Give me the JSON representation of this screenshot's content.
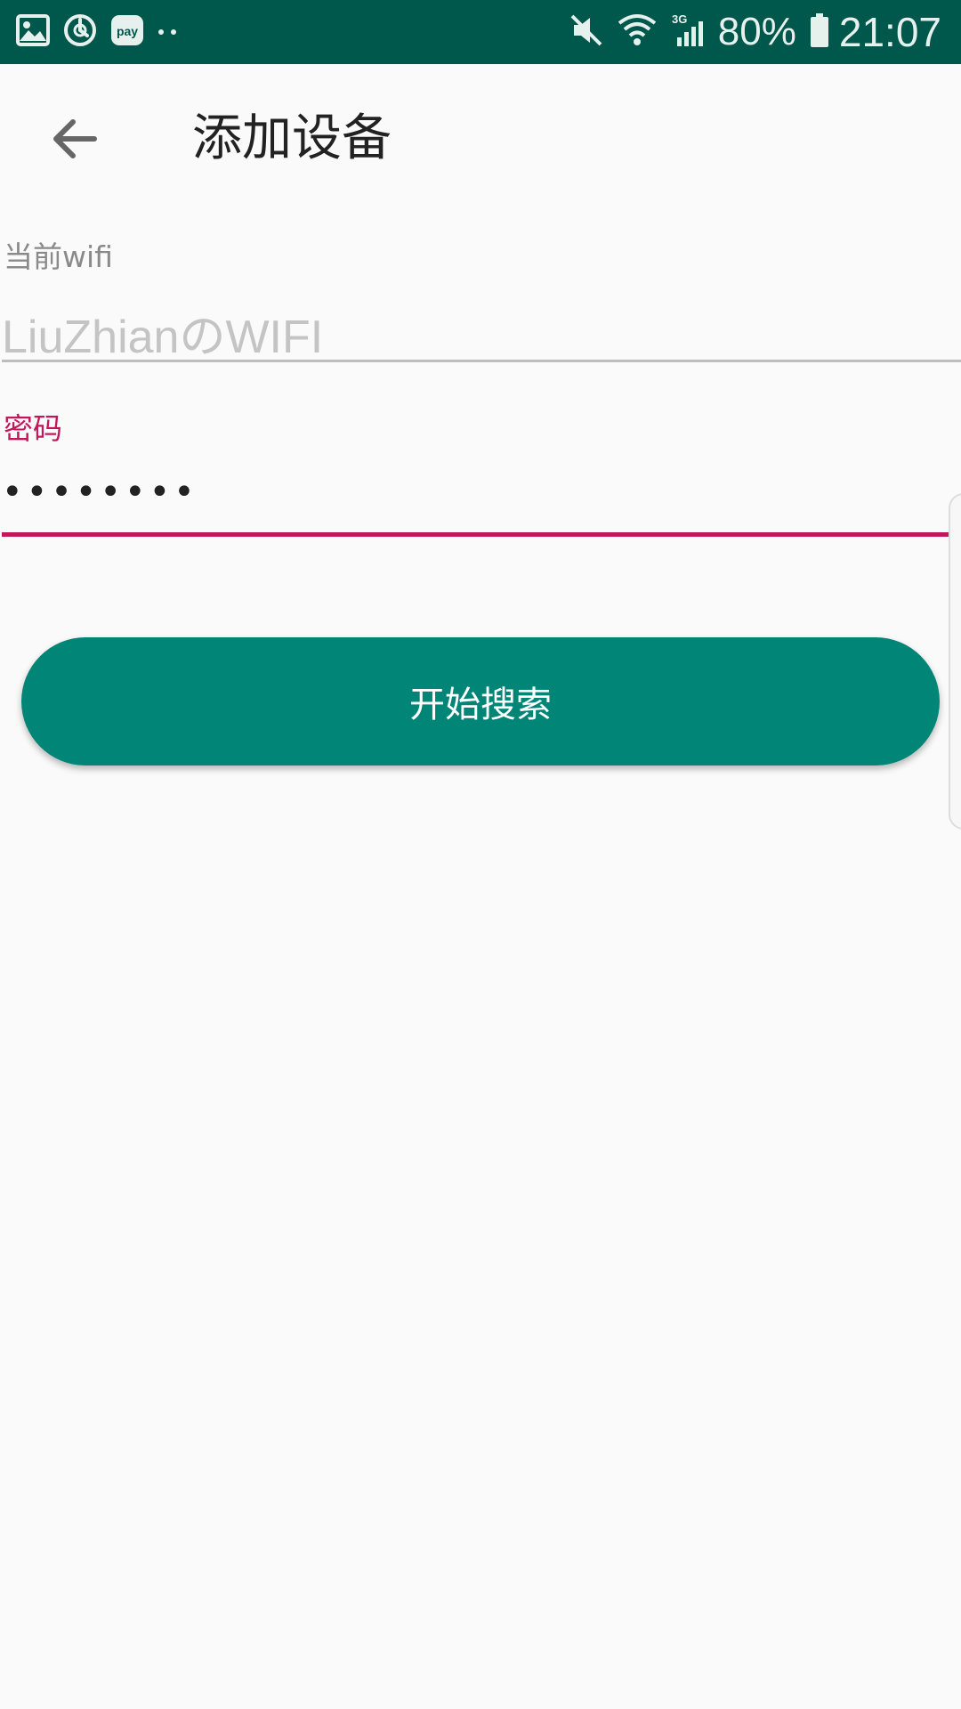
{
  "status_bar": {
    "left_icons": [
      "gallery-icon",
      "sync-icon",
      "pay-icon",
      "more-notifications-icon"
    ],
    "pay_label": "pay",
    "network_label": "3G",
    "battery_percent": "80%",
    "time": "21:07",
    "background_color": "#00574b"
  },
  "toolbar": {
    "back_icon": "arrow-left-icon",
    "title": "添加设备"
  },
  "form": {
    "wifi_label": "当前wifi",
    "wifi_value": "LiuZhianのWIFI",
    "password_label": "密码",
    "password_value": "••••••••"
  },
  "actions": {
    "start_search_label": "开始搜索",
    "button_color": "#018577"
  },
  "colors": {
    "accent": "#c2185b",
    "background": "#fafafa"
  }
}
